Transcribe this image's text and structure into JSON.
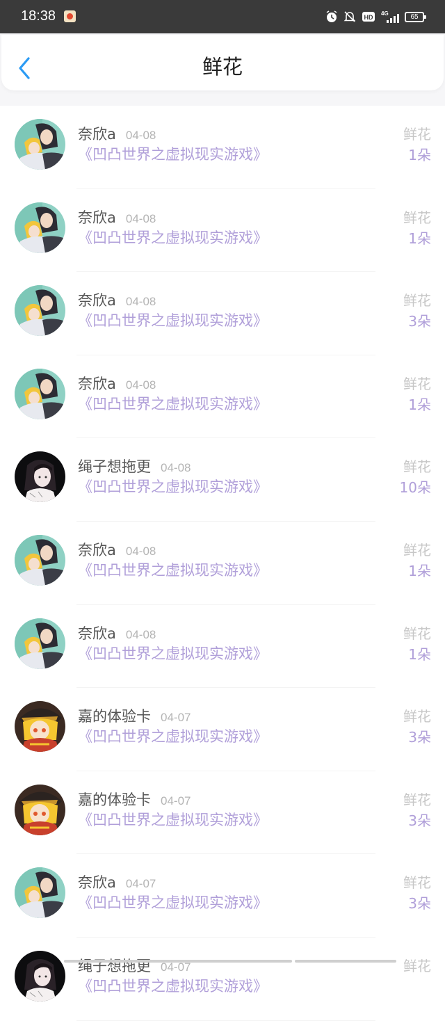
{
  "status_bar": {
    "time": "18:38",
    "network": "4G",
    "battery": "65"
  },
  "header": {
    "title": "鲜花"
  },
  "gifts": [
    {
      "user": "奈欣a",
      "date": "04-08",
      "book": "《凹凸世界之虚拟现实游戏》",
      "gift": "鲜花",
      "count": "1朵",
      "avatar": "avatar-a"
    },
    {
      "user": "奈欣a",
      "date": "04-08",
      "book": "《凹凸世界之虚拟现实游戏》",
      "gift": "鲜花",
      "count": "1朵",
      "avatar": "avatar-a"
    },
    {
      "user": "奈欣a",
      "date": "04-08",
      "book": "《凹凸世界之虚拟现实游戏》",
      "gift": "鲜花",
      "count": "3朵",
      "avatar": "avatar-a"
    },
    {
      "user": "奈欣a",
      "date": "04-08",
      "book": "《凹凸世界之虚拟现实游戏》",
      "gift": "鲜花",
      "count": "1朵",
      "avatar": "avatar-a"
    },
    {
      "user": "绳子想拖更",
      "date": "04-08",
      "book": "《凹凸世界之虚拟现实游戏》",
      "gift": "鲜花",
      "count": "10朵",
      "avatar": "avatar-b"
    },
    {
      "user": "奈欣a",
      "date": "04-08",
      "book": "《凹凸世界之虚拟现实游戏》",
      "gift": "鲜花",
      "count": "1朵",
      "avatar": "avatar-a"
    },
    {
      "user": "奈欣a",
      "date": "04-08",
      "book": "《凹凸世界之虚拟现实游戏》",
      "gift": "鲜花",
      "count": "1朵",
      "avatar": "avatar-a"
    },
    {
      "user": "嘉的体验卡",
      "date": "04-07",
      "book": "《凹凸世界之虚拟现实游戏》",
      "gift": "鲜花",
      "count": "3朵",
      "avatar": "avatar-c"
    },
    {
      "user": "嘉的体验卡",
      "date": "04-07",
      "book": "《凹凸世界之虚拟现实游戏》",
      "gift": "鲜花",
      "count": "3朵",
      "avatar": "avatar-c"
    },
    {
      "user": "奈欣a",
      "date": "04-07",
      "book": "《凹凸世界之虚拟现实游戏》",
      "gift": "鲜花",
      "count": "3朵",
      "avatar": "avatar-a"
    },
    {
      "user": "绳子想拖更",
      "date": "04-07",
      "book": "《凹凸世界之虚拟现实游戏》",
      "gift": "鲜花",
      "count": "",
      "avatar": "avatar-b"
    }
  ],
  "colors": {
    "accent": "#b09fd9",
    "back_arrow": "#2b9bf4",
    "status_bar": "#3a3a3a"
  }
}
